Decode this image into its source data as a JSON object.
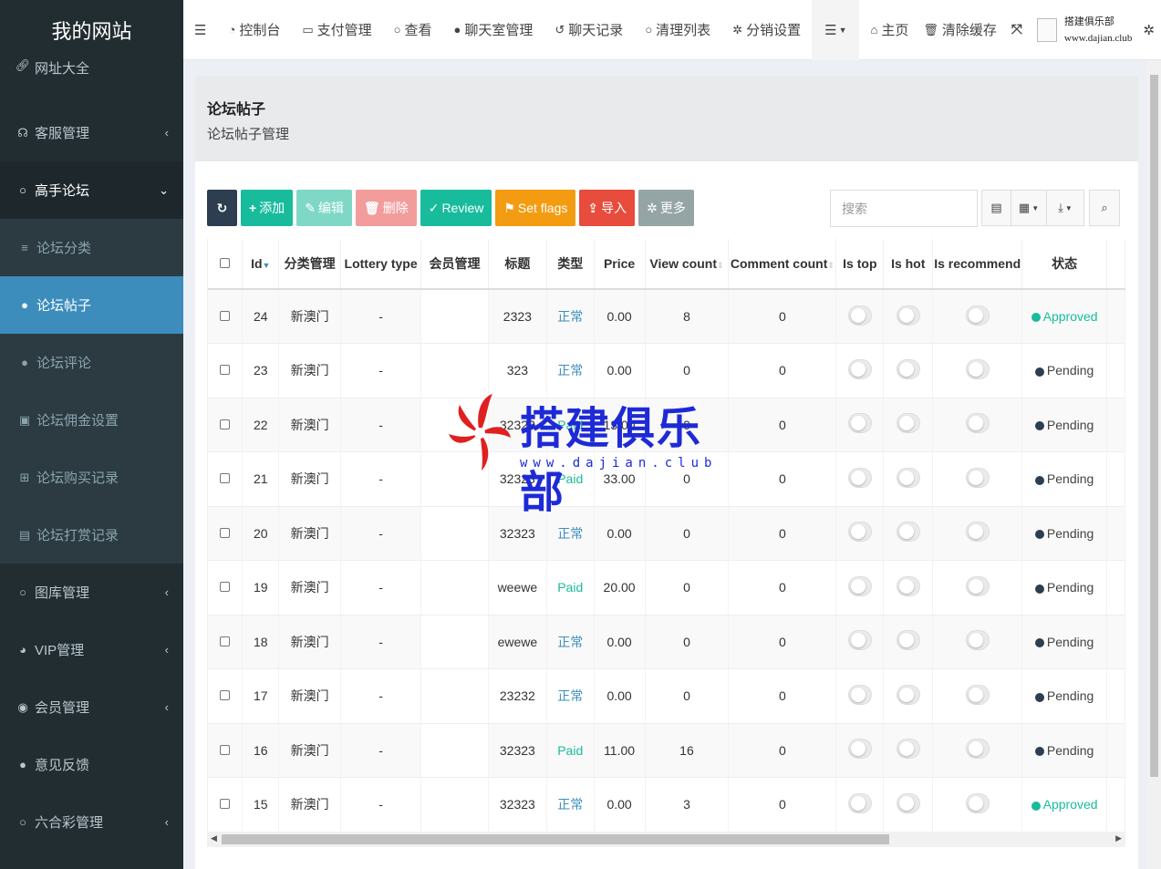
{
  "sidebar": {
    "brand": "我的网站",
    "items": [
      {
        "label": "网址大全",
        "icon": "link-icon"
      },
      {
        "label": "客服管理",
        "icon": "headset-icon",
        "chevron": "‹"
      },
      {
        "label": "高手论坛",
        "icon": "circle-icon",
        "chevron": "⌄"
      }
    ],
    "sub_items": [
      {
        "label": "论坛分类",
        "icon": "list-icon"
      },
      {
        "label": "论坛帖子",
        "icon": "comment-icon"
      },
      {
        "label": "论坛评论",
        "icon": "comments-icon"
      },
      {
        "label": "论坛佣金设置",
        "icon": "money-icon"
      },
      {
        "label": "论坛购买记录",
        "icon": "cart-icon"
      },
      {
        "label": "论坛打赏记录",
        "icon": "gift-icon"
      }
    ],
    "bottom_items": [
      {
        "label": "图库管理",
        "icon": "circle-icon",
        "chevron": "‹"
      },
      {
        "label": "VIP管理",
        "icon": "github-icon",
        "chevron": "‹"
      },
      {
        "label": "会员管理",
        "icon": "user-icon",
        "chevron": "‹"
      },
      {
        "label": "意见反馈",
        "icon": "comment-icon"
      },
      {
        "label": "六合彩管理",
        "icon": "circle-icon",
        "chevron": "‹"
      }
    ]
  },
  "topnav": {
    "menu_icon": "☰",
    "items": [
      {
        "label": "控制台",
        "icon": "dashboard-icon"
      },
      {
        "label": "支付管理",
        "icon": "credit-card-icon"
      },
      {
        "label": "查看",
        "icon": "circle-icon"
      },
      {
        "label": "聊天室管理",
        "icon": "comment-icon"
      },
      {
        "label": "聊天记录",
        "icon": "history-icon"
      },
      {
        "label": "清理列表",
        "icon": "circle-icon"
      },
      {
        "label": "分销设置",
        "icon": "cogs-icon"
      }
    ],
    "home_label": "主页",
    "clear_cache_label": "清除缓存",
    "user_name": "搭建俱乐部",
    "user_site": "www.dajian.club"
  },
  "content": {
    "title": "论坛帖子",
    "subtitle": "论坛帖子管理"
  },
  "toolbar": {
    "add": "添加",
    "edit": "编辑",
    "delete": "删除",
    "review": "Review",
    "set_flags": "Set flags",
    "import": "导入",
    "more": "更多"
  },
  "search": {
    "placeholder": "搜索"
  },
  "table": {
    "headers": {
      "id": "Id",
      "category": "分类管理",
      "lottery_type": "Lottery type",
      "member": "会员管理",
      "title": "标题",
      "type": "类型",
      "price": "Price",
      "view_count": "View count",
      "comment_count": "Comment count",
      "is_top": "Is top",
      "is_hot": "Is hot",
      "is_recommend": "Is recommend",
      "status": "状态"
    },
    "rows": [
      {
        "id": "24",
        "category": "新澳门",
        "lottery": "-",
        "member": "",
        "title": "2323",
        "type": "正常",
        "type_kind": "normal",
        "price": "0.00",
        "views": "8",
        "comments": "0",
        "status": "Approved",
        "status_kind": "approved"
      },
      {
        "id": "23",
        "category": "新澳门",
        "lottery": "-",
        "member": "",
        "title": "323",
        "type": "正常",
        "type_kind": "normal",
        "price": "0.00",
        "views": "0",
        "comments": "0",
        "status": "Pending",
        "status_kind": "pending"
      },
      {
        "id": "22",
        "category": "新澳门",
        "lottery": "-",
        "member": "",
        "title": "32323",
        "type": "Paid",
        "type_kind": "paid",
        "price": "13.00",
        "views": "0",
        "comments": "0",
        "status": "Pending",
        "status_kind": "pending"
      },
      {
        "id": "21",
        "category": "新澳门",
        "lottery": "-",
        "member": "",
        "title": "32323",
        "type": "Paid",
        "type_kind": "paid",
        "price": "33.00",
        "views": "0",
        "comments": "0",
        "status": "Pending",
        "status_kind": "pending"
      },
      {
        "id": "20",
        "category": "新澳门",
        "lottery": "-",
        "member": "",
        "title": "32323",
        "type": "正常",
        "type_kind": "normal",
        "price": "0.00",
        "views": "0",
        "comments": "0",
        "status": "Pending",
        "status_kind": "pending"
      },
      {
        "id": "19",
        "category": "新澳门",
        "lottery": "-",
        "member": "",
        "title": "weewe",
        "type": "Paid",
        "type_kind": "paid",
        "price": "20.00",
        "views": "0",
        "comments": "0",
        "status": "Pending",
        "status_kind": "pending"
      },
      {
        "id": "18",
        "category": "新澳门",
        "lottery": "-",
        "member": "",
        "title": "ewewe",
        "type": "正常",
        "type_kind": "normal",
        "price": "0.00",
        "views": "0",
        "comments": "0",
        "status": "Pending",
        "status_kind": "pending"
      },
      {
        "id": "17",
        "category": "新澳门",
        "lottery": "-",
        "member": "",
        "title": "23232",
        "type": "正常",
        "type_kind": "normal",
        "price": "0.00",
        "views": "0",
        "comments": "0",
        "status": "Pending",
        "status_kind": "pending"
      },
      {
        "id": "16",
        "category": "新澳门",
        "lottery": "-",
        "member": "",
        "title": "32323",
        "type": "Paid",
        "type_kind": "paid",
        "price": "11.00",
        "views": "16",
        "comments": "0",
        "status": "Pending",
        "status_kind": "pending"
      },
      {
        "id": "15",
        "category": "新澳门",
        "lottery": "-",
        "member": "",
        "title": "32323",
        "type": "正常",
        "type_kind": "normal",
        "price": "0.00",
        "views": "3",
        "comments": "0",
        "status": "Approved",
        "status_kind": "approved"
      }
    ]
  },
  "watermark": {
    "title": "搭建俱乐部",
    "url": "www.dajian.club"
  },
  "colors": {
    "sidebar_bg": "#222d32",
    "active": "#3c8dbc",
    "success": "#18bc9c",
    "warning": "#f39c12",
    "danger": "#e74c3c",
    "watermark_blue": "#1e2ad6",
    "watermark_red": "#e02020"
  }
}
